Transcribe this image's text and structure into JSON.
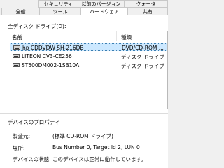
{
  "tabs": {
    "row1": [
      "セキュリティ",
      "以前のバージョン",
      "クォータ"
    ],
    "row2": [
      "全般",
      "ツール",
      "ハードウェア",
      "共有"
    ],
    "active": "ハードウェア"
  },
  "drives_label": "全ディスク ドライブ(D):",
  "columns": {
    "name": "名前",
    "type": "種類"
  },
  "drives": [
    {
      "name": "hp CDDVDW SH-216DB",
      "type": "DVD/CD-ROM ...",
      "selected": true
    },
    {
      "name": "LITEON CV3-CE256",
      "type": "ディスク ドライブ",
      "selected": false
    },
    {
      "name": "ST500DM002-1SB10A",
      "type": "ディスク ドライブ",
      "selected": false
    }
  ],
  "properties": {
    "title": "デバイスのプロパティ",
    "manufacturer_label": "製造元:",
    "manufacturer_value": "(標準 CD-ROM ドライブ)",
    "location_label": "場所:",
    "location_value": "Bus Number 0, Target Id 2, LUN 0",
    "status_label": "デバイスの状態:",
    "status_value": "このデバイスは正常に動作しています。"
  },
  "colors": {
    "selection": "#cce8ff",
    "panel": "#ffffff",
    "background": "#f0f0f0"
  }
}
